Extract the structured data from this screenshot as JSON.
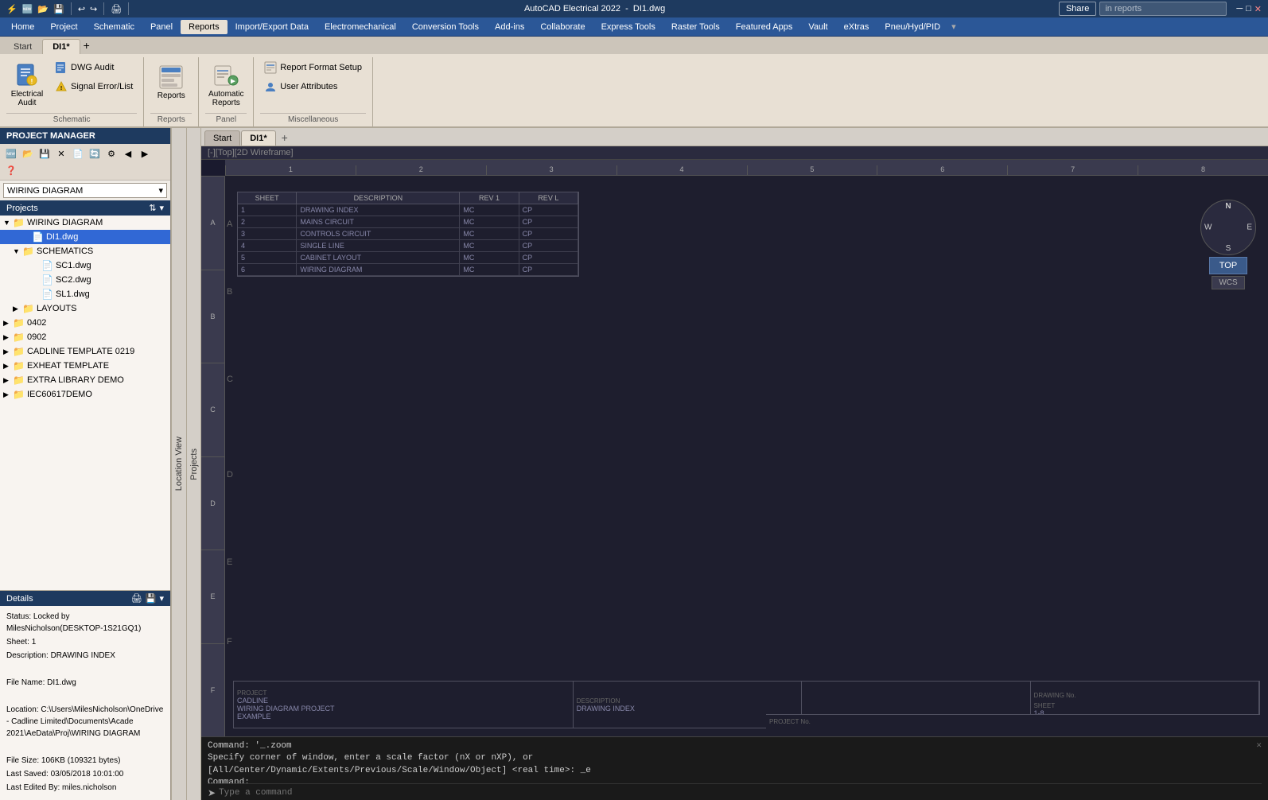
{
  "titlebar": {
    "app_name": "AutoCAD Electrical 2022",
    "file_name": "DI1.dwg",
    "search_placeholder": "in reports"
  },
  "quickaccess": {
    "share_label": "Share",
    "buttons": [
      "🆕",
      "📂",
      "💾",
      "💾",
      "↩",
      "🖨",
      "↩",
      "↪",
      "↩",
      "↪"
    ]
  },
  "menubar": {
    "items": [
      "Home",
      "Project",
      "Schematic",
      "Panel",
      "Reports",
      "Import/Export Data",
      "Electromechanical",
      "Conversion Tools",
      "Add-ins",
      "Collaborate",
      "Express Tools",
      "Raster Tools",
      "Featured Apps",
      "Vault",
      "eXtras",
      "Pneu/Hyd/PID"
    ]
  },
  "ribbon": {
    "tabs": [
      "Start",
      "DI1*"
    ],
    "active_tab": "DI1*",
    "groups": [
      {
        "name": "Schematic",
        "label": "Schematic",
        "buttons_large": [
          {
            "icon": "📋",
            "label": "Electrical Audit"
          },
          {
            "icon": "📄",
            "label": "DWG Audit"
          }
        ],
        "buttons_small": [
          {
            "icon": "⚠",
            "label": "Signal Error/List"
          }
        ]
      },
      {
        "name": "Reports",
        "label": "Reports",
        "button_large_icon": "📊",
        "button_large_label": "Reports"
      },
      {
        "name": "Panel",
        "label": "Panel",
        "button_large_icon": "🔧",
        "button_large_label": "Automatic Reports"
      },
      {
        "name": "Miscellaneous",
        "label": "Miscellaneous",
        "buttons": [
          {
            "icon": "📋",
            "label": "Report Format Setup"
          },
          {
            "icon": "👤",
            "label": "User Attributes"
          }
        ]
      }
    ]
  },
  "project_manager": {
    "title": "PROJECT MANAGER",
    "wiring_diagram": "WIRING DIAGRAM",
    "projects_label": "Projects",
    "tree": [
      {
        "level": 0,
        "icon": "📁",
        "label": "WIRING DIAGRAM",
        "expanded": true
      },
      {
        "level": 1,
        "icon": "📄",
        "label": "DI1.dwg",
        "selected": true
      },
      {
        "level": 1,
        "icon": "📁",
        "label": "SCHEMATICS",
        "expanded": true
      },
      {
        "level": 2,
        "icon": "📄",
        "label": "SC1.dwg"
      },
      {
        "level": 2,
        "icon": "📄",
        "label": "SC2.dwg"
      },
      {
        "level": 2,
        "icon": "📄",
        "label": "SL1.dwg"
      },
      {
        "level": 1,
        "icon": "📁",
        "label": "LAYOUTS"
      },
      {
        "level": 0,
        "icon": "📁",
        "label": "0402"
      },
      {
        "level": 0,
        "icon": "📁",
        "label": "0902"
      },
      {
        "level": 0,
        "icon": "📁",
        "label": "CADLINE TEMPLATE 0219"
      },
      {
        "level": 0,
        "icon": "📁",
        "label": "EXHEAT TEMPLATE"
      },
      {
        "level": 0,
        "icon": "📁",
        "label": "EXTRA LIBRARY DEMO"
      },
      {
        "level": 0,
        "icon": "📁",
        "label": "IEC60617DEMO"
      }
    ]
  },
  "details": {
    "title": "Details",
    "status": "Status: Locked by MilesNicholson(DESKTOP-1S21GQ1)",
    "sheet": "Sheet: 1",
    "description": "Description: DRAWING INDEX",
    "blank": "",
    "file_name": "File Name: DI1.dwg",
    "blank2": "",
    "location_label": "Location: C:\\Users\\MilesNicholson\\OneDrive - Cadline Limited\\Documents\\Acade 2021\\AeData\\Proj\\WIRING DIAGRAM",
    "blank3": "",
    "file_size": "File Size: 106KB (109321 bytes)",
    "last_saved": "Last Saved: 03/05/2018 10:01:00",
    "last_edited": "Last Edited By: miles.nicholson"
  },
  "canvas": {
    "view_label": "[-][Top][2D Wireframe]",
    "columns": [
      "1",
      "2",
      "3",
      "4",
      "5",
      "6",
      "7",
      "8"
    ],
    "rows": [
      "A",
      "B",
      "C",
      "D",
      "E",
      "F"
    ],
    "table_headers": [
      "SHEET",
      "DESCRIPTION",
      "REV 1",
      "REV L"
    ],
    "table_rows": [
      {
        "cells": [
          "1",
          "DRAWING INDEX",
          "MC",
          "CP"
        ]
      },
      {
        "cells": [
          "2",
          "MAINS CIRCUIT",
          "MC",
          "CP"
        ]
      },
      {
        "cells": [
          "3",
          "CONTROLS CIRCUIT",
          "MC",
          "CP"
        ]
      },
      {
        "cells": [
          "4",
          "SINGLE LINE",
          "MC",
          "CP"
        ]
      },
      {
        "cells": [
          "5",
          "CABINET LAYOUT",
          "MC",
          "CP"
        ]
      },
      {
        "cells": [
          "6",
          "WIRING DIAGRAM",
          "MC",
          "CP"
        ]
      }
    ],
    "nav_cube": {
      "n": "N",
      "s": "S",
      "e": "E",
      "w": "W",
      "top": "TOP",
      "wcs": "WCS"
    },
    "title_block": {
      "project_label": "PROJECT",
      "project_value": "CADLINE WIRING DIAGRAM PROJECT EXAMPLE",
      "description_label": "DESCRIPTION",
      "description_value": "DRAWING INDEX",
      "drawing_no_label": "DRAWING No.",
      "sheet_label": "SHEET",
      "sheet_value": "1-8",
      "project_no_label": "PROJECT No."
    }
  },
  "command_area": {
    "line1": "Command: '_.zoom",
    "line2": "Specify corner of window, enter a scale factor (nX or nXP), or",
    "line3": "[All/Center/Dynamic/Extents/Previous/Scale/Window/Object] <real time>: _e",
    "line4": "Command:",
    "prompt_placeholder": "Type a command"
  },
  "location_view": {
    "label": "Location View"
  },
  "projects_vtab": {
    "label": "Projects"
  }
}
